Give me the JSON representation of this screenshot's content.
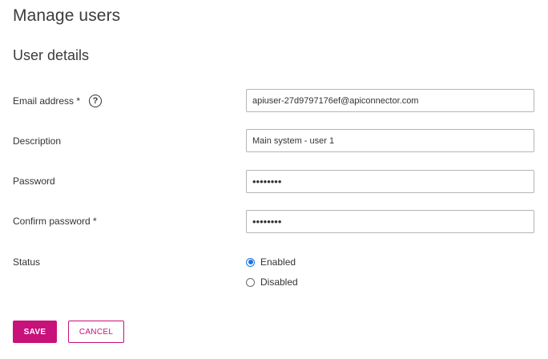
{
  "header": {
    "title": "Manage users",
    "section_title": "User details"
  },
  "form": {
    "email": {
      "label": "Email address *",
      "help_icon": "question-circle-icon",
      "value": "apiuser-27d9797176ef@apiconnector.com"
    },
    "description": {
      "label": "Description",
      "value": "Main system - user 1"
    },
    "password": {
      "label": "Password",
      "value": "••••••••"
    },
    "confirm_password": {
      "label": "Confirm password *",
      "value": "••••••••"
    },
    "status": {
      "label": "Status",
      "options": [
        {
          "label": "Enabled",
          "selected": true
        },
        {
          "label": "Disabled",
          "selected": false
        }
      ]
    }
  },
  "actions": {
    "save_label": "SAVE",
    "cancel_label": "CANCEL"
  },
  "colors": {
    "accent": "#c8117a",
    "radio_selected": "#1a73e8"
  }
}
